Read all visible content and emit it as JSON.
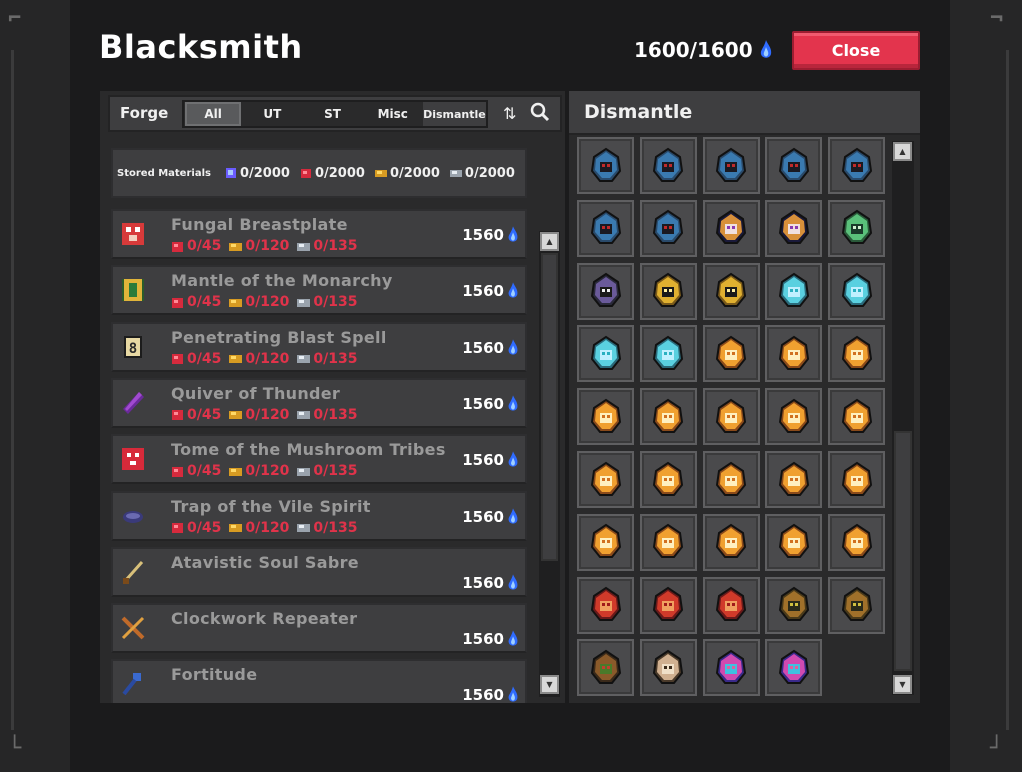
{
  "window": {
    "title": "Blacksmith",
    "currency_value": "1600/1600",
    "close_label": "Close"
  },
  "forge_bar": {
    "label": "Forge",
    "tabs": [
      "All",
      "UT",
      "ST",
      "Misc",
      "Dismantle"
    ],
    "active_tab": "All"
  },
  "stored": {
    "label": "Stored Materials",
    "materials": [
      {
        "icon": "blue-essence-icon",
        "value": "0/2000"
      },
      {
        "icon": "red-ore-icon",
        "value": "0/2000"
      },
      {
        "icon": "gold-ore-icon",
        "value": "0/2000"
      },
      {
        "icon": "silver-ore-icon",
        "value": "0/2000"
      }
    ]
  },
  "recipes": [
    {
      "name": "Fungal Breastplate",
      "icon": "mushroom-armor-icon",
      "req": [
        "0/45",
        "0/120",
        "0/135"
      ],
      "cost": "1560"
    },
    {
      "name": "Mantle of the Monarchy",
      "icon": "gold-robe-icon",
      "req": [
        "0/45",
        "0/120",
        "0/135"
      ],
      "cost": "1560"
    },
    {
      "name": "Penetrating Blast Spell",
      "icon": "spell-scroll-icon",
      "req": [
        "0/45",
        "0/120",
        "0/135"
      ],
      "cost": "1560"
    },
    {
      "name": "Quiver of Thunder",
      "icon": "purple-quiver-icon",
      "req": [
        "0/45",
        "0/120",
        "0/135"
      ],
      "cost": "1560"
    },
    {
      "name": "Tome of the Mushroom Tribes",
      "icon": "mushroom-tome-icon",
      "req": [
        "0/45",
        "0/120",
        "0/135"
      ],
      "cost": "1560"
    },
    {
      "name": "Trap of the Vile Spirit",
      "icon": "spirit-trap-icon",
      "req": [
        "0/45",
        "0/120",
        "0/135"
      ],
      "cost": "1560"
    },
    {
      "name": "Atavistic Soul Sabre",
      "icon": "sabre-icon",
      "req": [],
      "cost": "1560"
    },
    {
      "name": "Clockwork Repeater",
      "icon": "crossbow-icon",
      "req": [],
      "cost": "1560"
    },
    {
      "name": "Fortitude",
      "icon": "fortitude-icon",
      "req": [],
      "cost": "1560"
    }
  ],
  "dismantle": {
    "title": "Dismantle",
    "items": [
      "dark-hood-icon",
      "dark-hood-icon",
      "dark-hood-icon",
      "dark-hood-icon",
      "dark-hood-icon",
      "dark-hood-icon",
      "dark-hood-icon",
      "jester-mask-icon",
      "jester-mask-icon",
      "green-skull-icon",
      "purple-orb-icon",
      "gold-helm-icon",
      "gold-helm-icon",
      "cyan-cross-icon",
      "cyan-cross-icon",
      "cyan-cross-icon",
      "cyan-cross-icon",
      "orange-egg-icon",
      "orange-egg-icon",
      "orange-egg-icon",
      "orange-egg-icon",
      "orange-egg-icon",
      "orange-egg-icon",
      "orange-egg-icon",
      "orange-egg-icon",
      "orange-egg-icon",
      "orange-egg-icon",
      "orange-egg-icon",
      "orange-egg-icon",
      "orange-egg-icon",
      "orange-egg-icon",
      "orange-egg-icon",
      "orange-egg-icon",
      "orange-egg-icon",
      "orange-egg-icon",
      "red-egg-icon",
      "red-egg-icon",
      "red-egg-icon",
      "bronze-mask-icon",
      "bronze-mask-icon",
      "wreath-icon",
      "skull-bone-icon",
      "rainbow-egg-icon",
      "rainbow-egg-icon"
    ]
  },
  "colors": {
    "accent_red": "#e3344d",
    "req_red": "#e0334a",
    "essence_blue": "#3a7bff"
  }
}
